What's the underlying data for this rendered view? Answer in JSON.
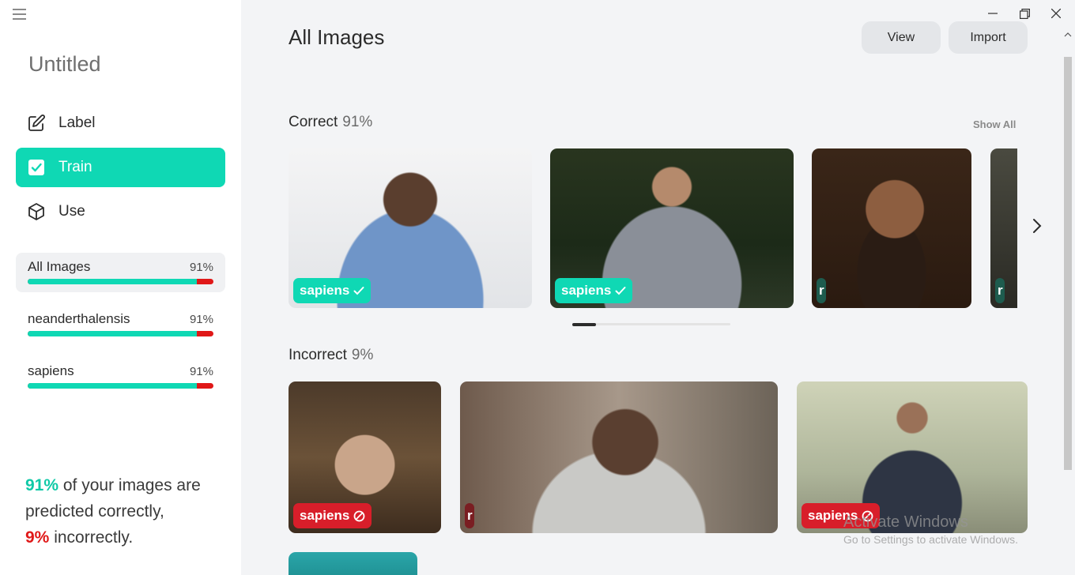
{
  "sidebar": {
    "project_title": "Untitled",
    "nav": [
      {
        "label": "Label",
        "icon": "edit-icon",
        "active": false
      },
      {
        "label": "Train",
        "icon": "checkbox-icon",
        "active": true
      },
      {
        "label": "Use",
        "icon": "cube-icon",
        "active": false
      }
    ],
    "classes": [
      {
        "name": "All Images",
        "accuracy": "91%",
        "correct_fraction": 0.91,
        "selected": true
      },
      {
        "name": "neanderthalensis",
        "accuracy": "91%",
        "correct_fraction": 0.91,
        "selected": false
      },
      {
        "name": "sapiens",
        "accuracy": "91%",
        "correct_fraction": 0.91,
        "selected": false
      }
    ],
    "summary": {
      "correct_pct": "91%",
      "text_a": " of your images are predicted correctly,",
      "incorrect_pct": "9%",
      "text_b": " incorrectly."
    }
  },
  "header": {
    "title": "All Images",
    "view_label": "View",
    "import_label": "Import"
  },
  "correct_section": {
    "title": "Correct",
    "pct": "91%",
    "show_all": "Show All",
    "items": [
      {
        "label": "sapiens",
        "status": "correct"
      },
      {
        "label": "sapiens",
        "status": "correct"
      },
      {
        "label": "r",
        "status": "correct"
      },
      {
        "label": "r",
        "status": "correct"
      }
    ],
    "carousel_position": 0.0
  },
  "incorrect_section": {
    "title": "Incorrect",
    "pct": "9%",
    "items": [
      {
        "label": "sapiens",
        "status": "incorrect"
      },
      {
        "label": "r",
        "status": "incorrect"
      },
      {
        "label": "sapiens",
        "status": "incorrect"
      },
      {
        "label": "",
        "status": "incorrect"
      }
    ]
  },
  "watermark": {
    "line1": "Activate Windows",
    "line2": "Go to Settings to activate Windows."
  },
  "colors": {
    "accent": "#0fd8b4",
    "error": "#e01818",
    "background": "#f3f4f6"
  }
}
